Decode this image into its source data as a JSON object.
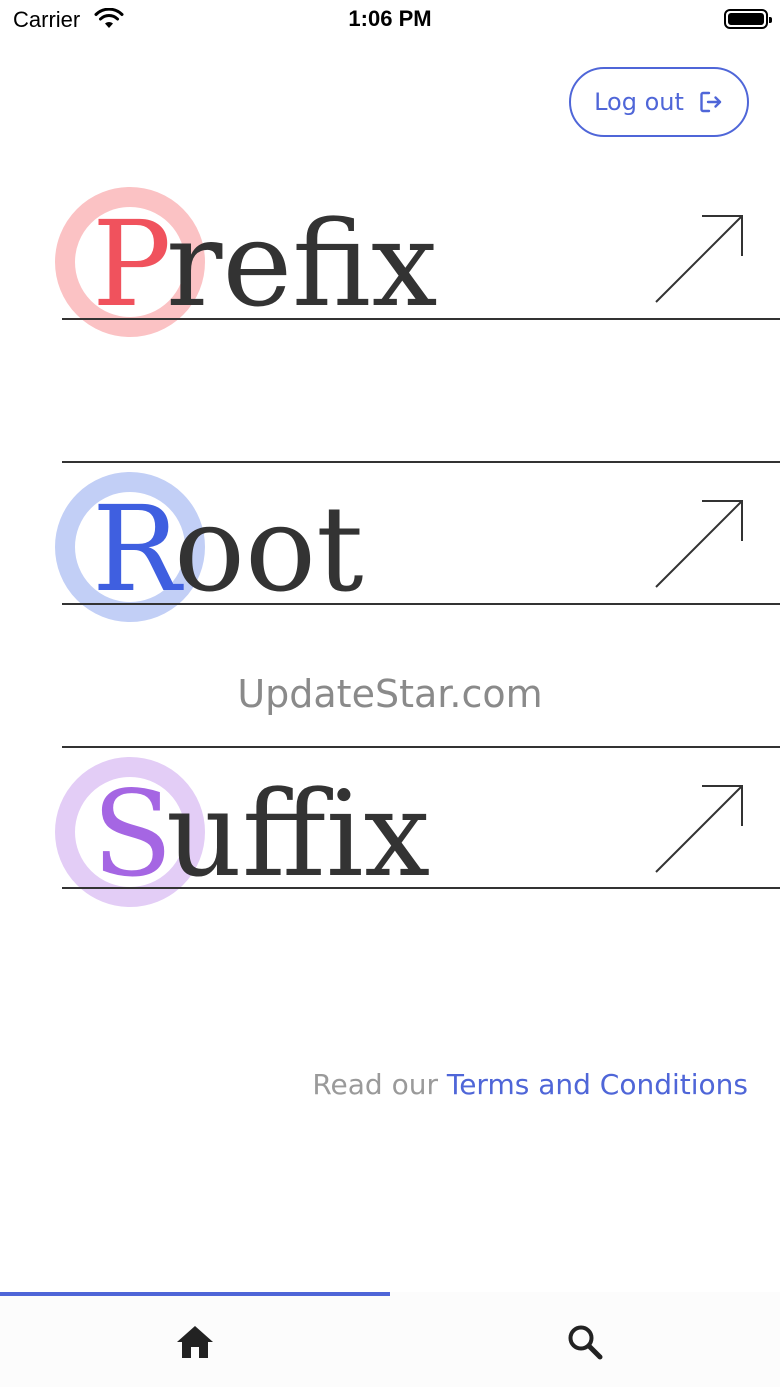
{
  "status_bar": {
    "carrier": "Carrier",
    "time": "1:06 PM"
  },
  "header": {
    "logout_label": "Log out"
  },
  "sections": [
    {
      "initial": "P",
      "rest": "refix",
      "accent": "#f0525d",
      "ring": "#fbc2c4"
    },
    {
      "initial": "R",
      "rest": "oot",
      "accent": "#3f5fe0",
      "ring": "#c2cff6"
    },
    {
      "initial": "S",
      "rest": "uffix",
      "accent": "#a566e3",
      "ring": "#e3cdf6"
    }
  ],
  "watermark": "UpdateStar.com",
  "footer": {
    "prefix_text": "Read our ",
    "link_text": "Terms and Conditions"
  },
  "tabs": [
    {
      "icon": "home-icon",
      "active": true
    },
    {
      "icon": "search-icon",
      "active": false
    }
  ],
  "colors": {
    "accent": "#4f66d8",
    "text": "#333333"
  }
}
